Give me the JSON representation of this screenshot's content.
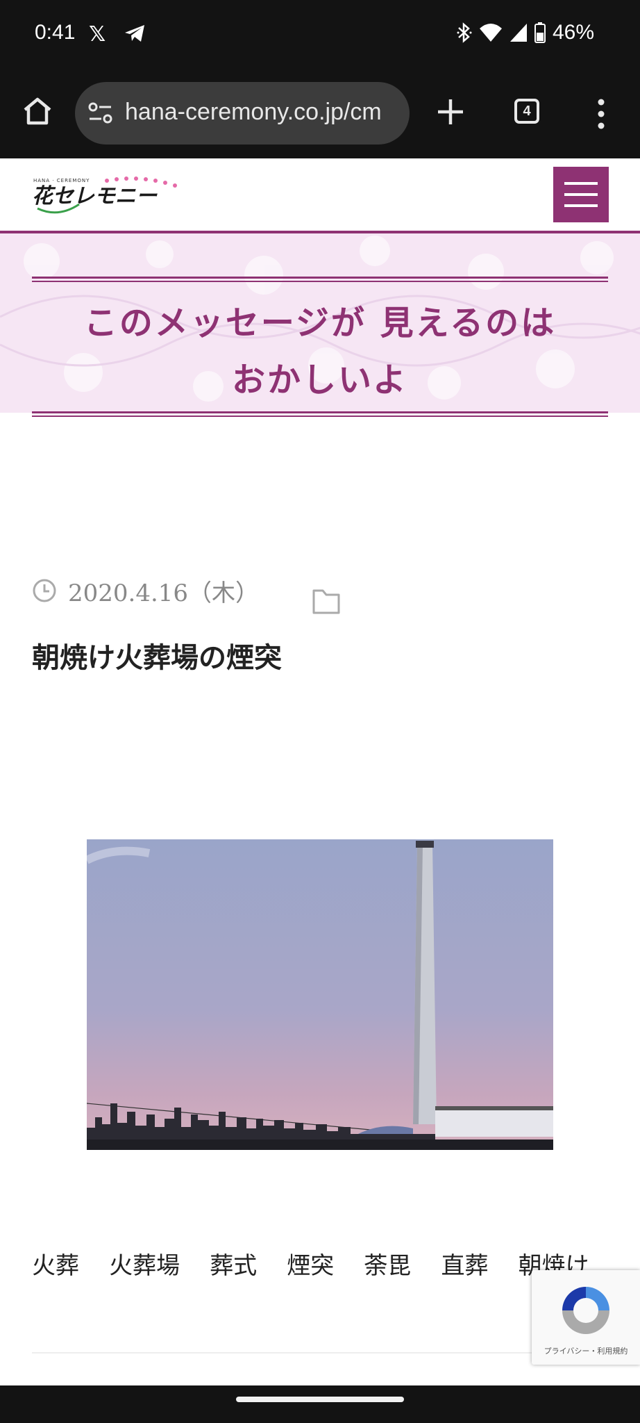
{
  "status_bar": {
    "time": "0:41",
    "battery": "46%",
    "icons": [
      "x-logo-icon",
      "telegram-icon",
      "bluetooth-icon",
      "wifi-icon",
      "signal-icon",
      "battery-icon"
    ]
  },
  "browser": {
    "url": "hana-ceremony.co.jp/cm",
    "tab_count": "4",
    "icons": [
      "home-icon",
      "site-settings-icon",
      "plus-icon",
      "tabs-icon",
      "more-vert-icon"
    ]
  },
  "site": {
    "logo_alt": "花セレモニー",
    "logo_sub": "HANA · CEREMONY",
    "brand_color": "#8e3273",
    "banner_line1": "このメッセージが 見えるのは",
    "banner_line2": "おかしいよ"
  },
  "post": {
    "date": "2020.4.16（木）",
    "title": "朝焼け火葬場の煙突",
    "tags": [
      "火葬",
      "火葬場",
      "葬式",
      "煙突",
      "荼毘",
      "直葬",
      "朝焼け"
    ]
  },
  "recaptcha": {
    "links": "プライバシー・利用規約"
  }
}
